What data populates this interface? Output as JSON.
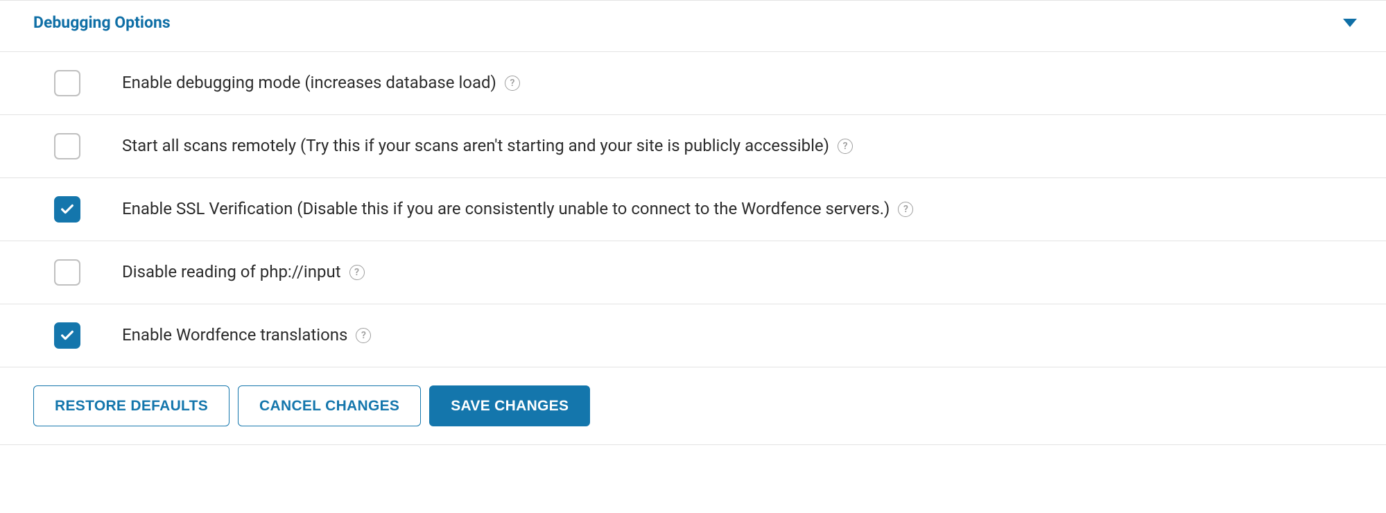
{
  "panel": {
    "title": "Debugging Options"
  },
  "options": [
    {
      "label": "Enable debugging mode (increases database load)",
      "checked": false
    },
    {
      "label": "Start all scans remotely (Try this if your scans aren't starting and your site is publicly accessible)",
      "checked": false
    },
    {
      "label": "Enable SSL Verification (Disable this if you are consistently unable to connect to the Wordfence servers.)",
      "checked": true
    },
    {
      "label": "Disable reading of php://input",
      "checked": false
    },
    {
      "label": "Enable Wordfence translations",
      "checked": true
    }
  ],
  "actions": {
    "restore": "RESTORE DEFAULTS",
    "cancel": "CANCEL CHANGES",
    "save": "SAVE CHANGES"
  }
}
